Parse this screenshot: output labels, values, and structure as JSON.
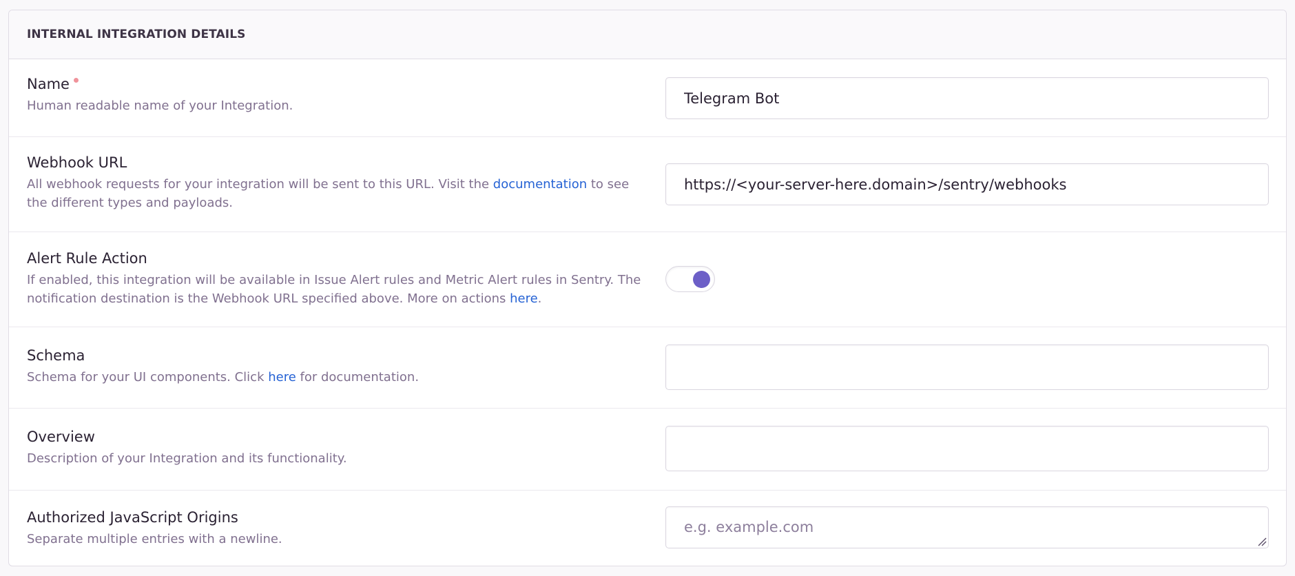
{
  "section": {
    "title": "INTERNAL INTEGRATION DETAILS"
  },
  "fields": {
    "name": {
      "label": "Name",
      "help": "Human readable name of your Integration.",
      "value": "Telegram Bot"
    },
    "webhook_url": {
      "label": "Webhook URL",
      "help_before": "All webhook requests for your integration will be sent to this URL. Visit the ",
      "help_link": "documentation",
      "help_after": " to see the different types and payloads.",
      "value": "https://<your-server-here.domain>/sentry/webhooks"
    },
    "alert_rule_action": {
      "label": "Alert Rule Action",
      "help_before": "If enabled, this integration will be available in Issue Alert rules and Metric Alert rules in Sentry. The notification destination is the Webhook URL specified above. More on actions ",
      "help_link": "here",
      "help_after": ".",
      "enabled": true
    },
    "schema": {
      "label": "Schema",
      "help_before": "Schema for your UI components. Click ",
      "help_link": "here",
      "help_after": " for documentation.",
      "value": ""
    },
    "overview": {
      "label": "Overview",
      "help": "Description of your Integration and its functionality.",
      "value": ""
    },
    "authorized_origins": {
      "label": "Authorized JavaScript Origins",
      "help": "Separate multiple entries with a newline.",
      "placeholder": "e.g. example.com",
      "value": ""
    }
  },
  "colors": {
    "accent": "#6c5fc7",
    "link": "#2562d4",
    "required": "#f0939b"
  }
}
